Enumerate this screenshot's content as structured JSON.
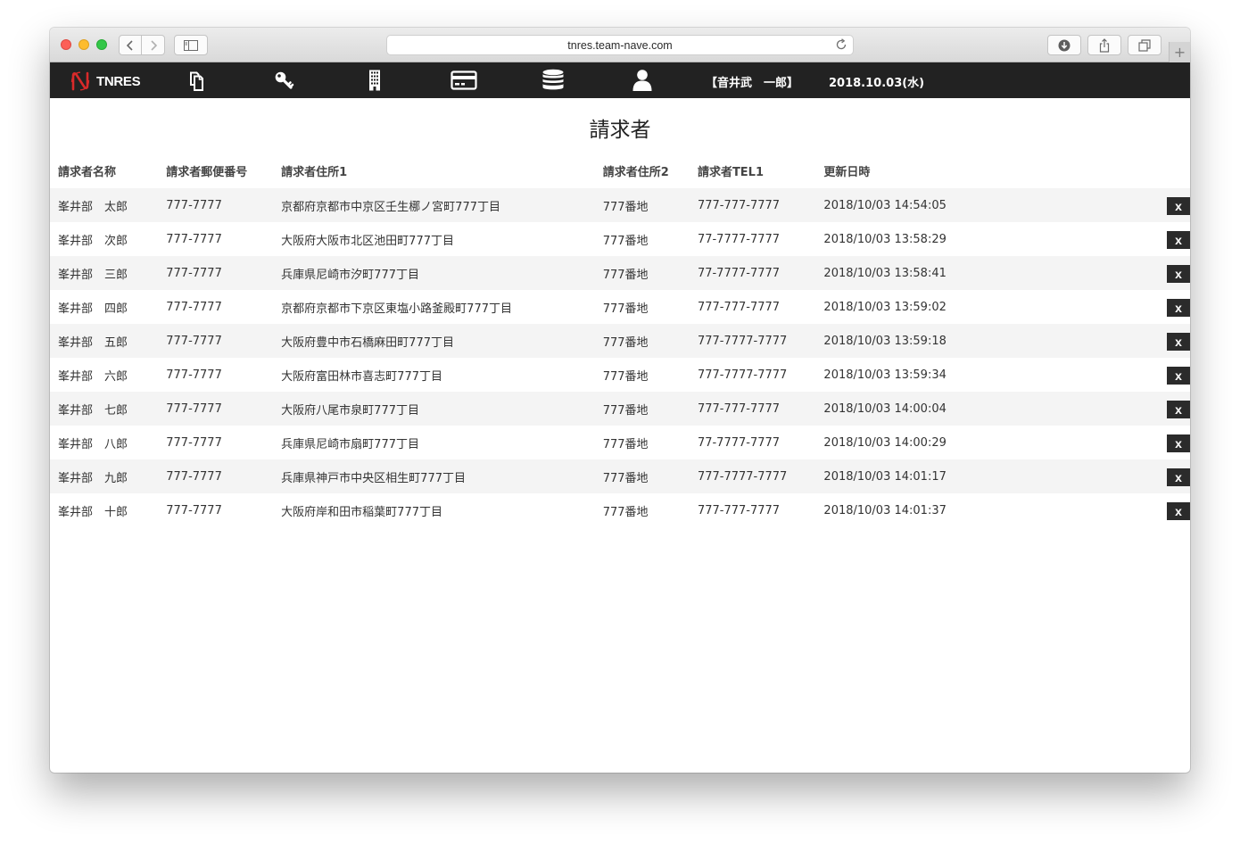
{
  "browser": {
    "url": "tnres.team-nave.com"
  },
  "navbar": {
    "brand": "TNRES",
    "items": [
      {
        "icon": "copy-icon"
      },
      {
        "icon": "key-icon"
      },
      {
        "icon": "building-icon"
      },
      {
        "icon": "credit-card-icon"
      },
      {
        "icon": "database-icon"
      },
      {
        "icon": "user-icon"
      }
    ],
    "user": "【音井武　一郎】",
    "date": "2018.10.03(水)"
  },
  "page": {
    "title": "請求者"
  },
  "table": {
    "headers": [
      "請求者名称",
      "請求者郵便番号",
      "請求者住所1",
      "請求者住所2",
      "請求者TEL1",
      "更新日時"
    ],
    "delete_label": "x",
    "rows": [
      [
        "峯井部　太郎",
        "777-7777",
        "京都府京都市中京区壬生梛ノ宮町777丁目",
        "777番地",
        "777-777-7777",
        "2018/10/03 14:54:05"
      ],
      [
        "峯井部　次郎",
        "777-7777",
        "大阪府大阪市北区池田町777丁目",
        "777番地",
        "77-7777-7777",
        "2018/10/03 13:58:29"
      ],
      [
        "峯井部　三郎",
        "777-7777",
        "兵庫県尼崎市汐町777丁目",
        "777番地",
        "77-7777-7777",
        "2018/10/03 13:58:41"
      ],
      [
        "峯井部　四郎",
        "777-7777",
        "京都府京都市下京区東塩小路釜殿町777丁目",
        "777番地",
        "777-777-7777",
        "2018/10/03 13:59:02"
      ],
      [
        "峯井部　五郎",
        "777-7777",
        "大阪府豊中市石橋麻田町777丁目",
        "777番地",
        "777-7777-7777",
        "2018/10/03 13:59:18"
      ],
      [
        "峯井部　六郎",
        "777-7777",
        "大阪府富田林市喜志町777丁目",
        "777番地",
        "777-7777-7777",
        "2018/10/03 13:59:34"
      ],
      [
        "峯井部　七郎",
        "777-7777",
        "大阪府八尾市泉町777丁目",
        "777番地",
        "777-777-7777",
        "2018/10/03 14:00:04"
      ],
      [
        "峯井部　八郎",
        "777-7777",
        "兵庫県尼崎市扇町777丁目",
        "777番地",
        "77-7777-7777",
        "2018/10/03 14:00:29"
      ],
      [
        "峯井部　九郎",
        "777-7777",
        "兵庫県神戸市中央区相生町777丁目",
        "777番地",
        "777-7777-7777",
        "2018/10/03 14:01:17"
      ],
      [
        "峯井部　十郎",
        "777-7777",
        "大阪府岸和田市稲葉町777丁目",
        "777番地",
        "777-777-7777",
        "2018/10/03 14:01:37"
      ]
    ]
  }
}
